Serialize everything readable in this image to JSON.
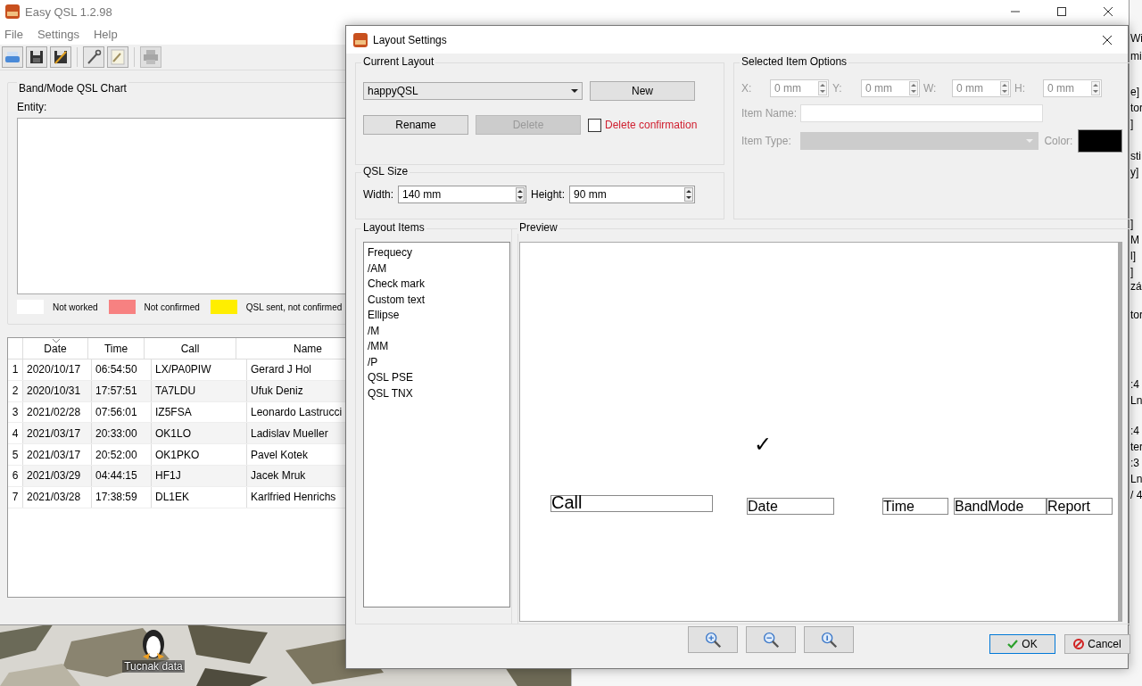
{
  "main_window": {
    "title": "Easy QSL 1.2.98",
    "menu": [
      "File",
      "Settings",
      "Help"
    ],
    "chart": {
      "title": "Band/Mode QSL Chart",
      "entity_label": "Entity:",
      "legend": [
        {
          "label": "Not worked",
          "color": "#ffffff"
        },
        {
          "label": "Not confirmed",
          "color": "#f78181"
        },
        {
          "label": "QSL sent, not confirmed",
          "color": "#ffee00"
        }
      ]
    },
    "table": {
      "columns": [
        {
          "label": "Date",
          "sorted": true
        },
        {
          "label": "Time",
          "sorted": false
        },
        {
          "label": "Call",
          "sorted": false
        },
        {
          "label": "Name",
          "sorted": false
        }
      ],
      "rows": [
        {
          "number": "1",
          "cells": [
            "2020/10/17",
            "06:54:50",
            "LX/PA0PIW",
            "Gerard J Hol"
          ]
        },
        {
          "number": "2",
          "cells": [
            "2020/10/31",
            "17:57:51",
            "TA7LDU",
            "Ufuk Deniz"
          ]
        },
        {
          "number": "3",
          "cells": [
            "2021/02/28",
            "07:56:01",
            "IZ5FSA",
            "Leonardo Lastrucci"
          ]
        },
        {
          "number": "4",
          "cells": [
            "2021/03/17",
            "20:33:00",
            "OK1LO",
            "Ladislav Mueller"
          ]
        },
        {
          "number": "5",
          "cells": [
            "2021/03/17",
            "20:52:00",
            "OK1PKO",
            "Pavel Kotek"
          ]
        },
        {
          "number": "6",
          "cells": [
            "2021/03/29",
            "04:44:15",
            "HF1J",
            "Jacek Mruk"
          ]
        },
        {
          "number": "7",
          "cells": [
            "2021/03/28",
            "17:38:59",
            "DL1EK",
            "Karlfried Henrichs"
          ]
        }
      ]
    }
  },
  "dialog": {
    "title": "Layout Settings",
    "current_layout": {
      "title": "Current Layout",
      "layout": "happyQSL",
      "new_button": "New",
      "rename_button": "Rename",
      "delete_button": {
        "label": "Delete",
        "disabled": true
      },
      "confirmation": {
        "label": "Delete confirmation",
        "checked": false
      }
    },
    "qsl_size": {
      "title": "QSL Size",
      "fields": [
        {
          "label": "Width:",
          "value": "140 mm"
        },
        {
          "label": "Height:",
          "value": "90 mm"
        }
      ]
    },
    "item_options": {
      "title": "Selected Item Options",
      "disabled": true,
      "coords": [
        {
          "label": "X:",
          "value": "0 mm"
        },
        {
          "label": "Y:",
          "value": "0 mm"
        },
        {
          "label": "W:",
          "value": "0 mm"
        },
        {
          "label": "H:",
          "value": "0 mm"
        }
      ],
      "name_label": "Item Name:",
      "type_label": "Item Type:",
      "color_label": "Color:",
      "color": "#000000"
    },
    "layout_items": {
      "title": "Layout Items",
      "items": [
        "Frequecy",
        "/AM",
        "Check mark",
        "Custom text",
        "Ellipse",
        "/M",
        "/MM",
        "/P",
        "QSL PSE",
        "QSL TNX"
      ]
    },
    "preview": {
      "title": "Preview",
      "items": [
        {
          "kind": "mark",
          "text": "✓"
        },
        {
          "kind": "field",
          "text": "Call"
        },
        {
          "kind": "field",
          "text": "Date"
        },
        {
          "kind": "field",
          "text": "Time"
        },
        {
          "kind": "field",
          "text": "BandMode"
        },
        {
          "kind": "field",
          "text": "Report"
        }
      ]
    },
    "ok_button": "OK",
    "cancel_button": "Cancel"
  },
  "desktop": {
    "icon_label": "Tucnak data"
  },
  "background_window": {
    "fragments": [
      "Wi",
      "mi",
      "e]",
      "tor",
      "]",
      "sti",
      "y]",
      "]",
      "M",
      "l]",
      "]",
      "zá",
      "tor",
      ":4",
      "Ln",
      ":4",
      "ter",
      ":3",
      "Ln",
      "/ 4"
    ]
  }
}
